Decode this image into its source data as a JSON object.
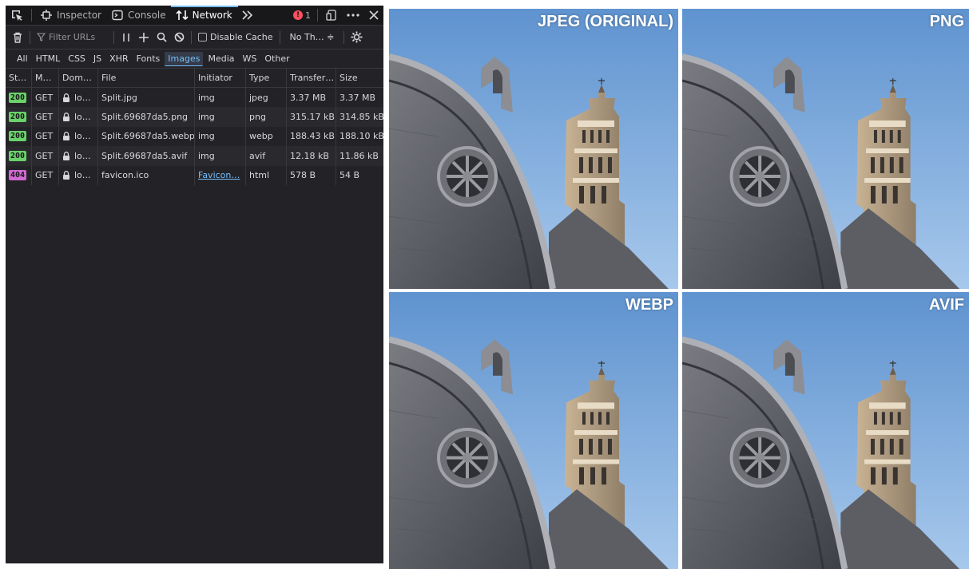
{
  "toolbar": {
    "tabs": [
      {
        "label": "Inspector",
        "icon": "inspector-icon"
      },
      {
        "label": "Console",
        "icon": "console-icon"
      },
      {
        "label": "Network",
        "icon": "network-icon",
        "active": true
      }
    ],
    "error_count": "1"
  },
  "filterbar": {
    "filter_placeholder": "Filter URLs",
    "disable_cache_label": "Disable Cache",
    "throttle_label": "No Th… ≑"
  },
  "typefilters": [
    "All",
    "HTML",
    "CSS",
    "JS",
    "XHR",
    "Fonts",
    "Images",
    "Media",
    "WS",
    "Other"
  ],
  "active_type": "Images",
  "table": {
    "columns": [
      "St…",
      "M…",
      "Dom…",
      "File",
      "Initiator",
      "Type",
      "Transfer…",
      "Size"
    ],
    "rows": [
      {
        "status": "200",
        "method": "GET",
        "domain": "lo…",
        "file": "Split.jpg",
        "initiator": "img",
        "type": "jpeg",
        "transfer": "3.37 MB",
        "size": "3.37 MB"
      },
      {
        "status": "200",
        "method": "GET",
        "domain": "lo…",
        "file": "Split.69687da5.png",
        "initiator": "img",
        "type": "png",
        "transfer": "315.17 kB",
        "size": "314.85 kB"
      },
      {
        "status": "200",
        "method": "GET",
        "domain": "lo…",
        "file": "Split.69687da5.webp",
        "initiator": "img",
        "type": "webp",
        "transfer": "188.43 kB",
        "size": "188.10 kB"
      },
      {
        "status": "200",
        "method": "GET",
        "domain": "lo…",
        "file": "Split.69687da5.avif",
        "initiator": "img",
        "type": "avif",
        "transfer": "12.18 kB",
        "size": "11.86 kB"
      },
      {
        "status": "404",
        "method": "GET",
        "domain": "lo…",
        "file": "favicon.ico",
        "initiator": "Favicon…",
        "type": "html",
        "transfer": "578 B",
        "size": "54 B"
      }
    ]
  },
  "images": {
    "jpeg_label": "JPEG (ORIGINAL)",
    "png_label": "PNG",
    "webp_label": "WEBP",
    "avif_label": "AVIF"
  },
  "colors": {
    "status_ok": "#6ad26a",
    "status_notfound": "#d26ad2",
    "accent": "#75bfff"
  }
}
